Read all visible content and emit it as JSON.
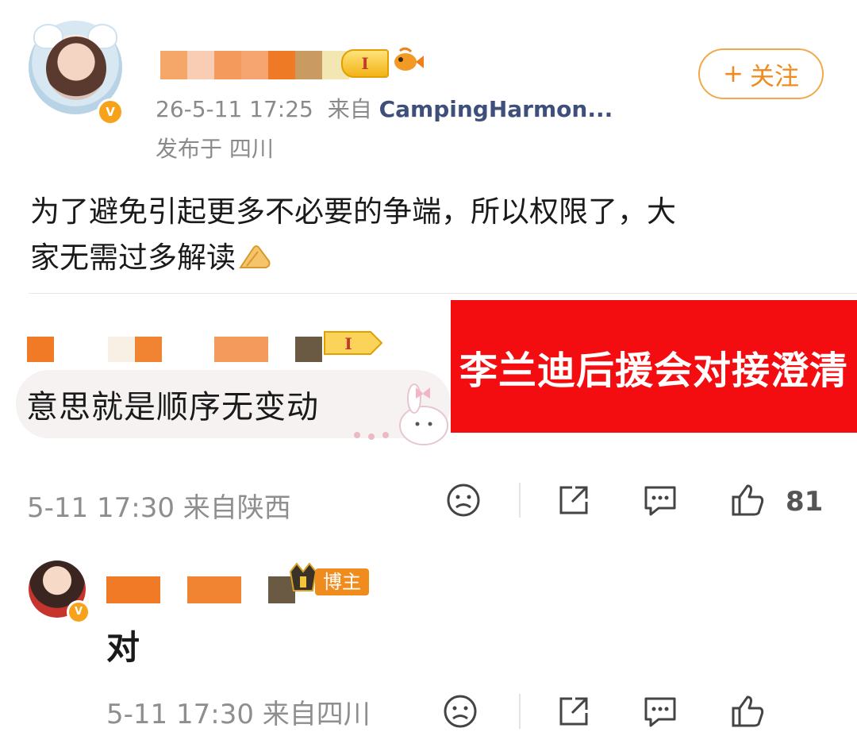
{
  "post": {
    "timestamp": "26-5-11 17:25",
    "source_prefix": "来自",
    "source_device": "CampingHarmon...",
    "location": "发布于 四川",
    "body_line1": "为了避免引起更多不必要的争端，所以权限了，大",
    "body_line2": "家无需过多解读",
    "verified_mark": "V",
    "level_mark": "I"
  },
  "follow_button": {
    "plus": "+",
    "label": "关注"
  },
  "comment": {
    "text": "意思就是顺序无变动",
    "meta": "5-11 17:30 来自陕西",
    "like_count": "81",
    "level_mark": "I"
  },
  "banner": {
    "text": "李兰迪后援会对接澄清"
  },
  "reply": {
    "tag": "博主",
    "text": "对",
    "meta": "5-11 17:30 来自四川",
    "verified_mark": "V"
  },
  "colors": {
    "accent_orange": "#f08a1c",
    "banner_red": "#f30c10",
    "meta_gray": "#8e8e8e",
    "source_blue": "#3d4f7a"
  },
  "icons": [
    "fish-icon",
    "pray-hands-icon",
    "sad-face-icon",
    "share-icon",
    "comment-icon",
    "thumbs-up-icon",
    "bunny-sticker-icon",
    "crown-icon"
  ]
}
